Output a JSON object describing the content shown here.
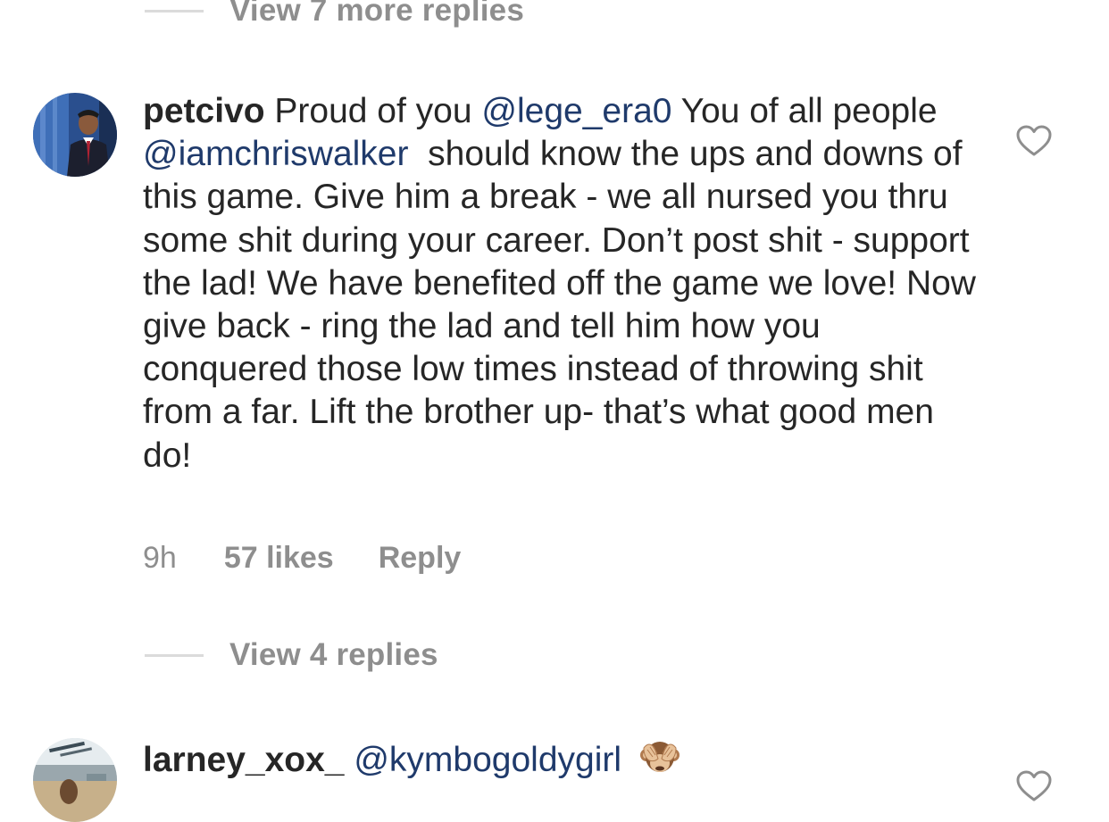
{
  "thread_top": {
    "view_replies_label": "View 7 more replies"
  },
  "comment_1": {
    "username": "petcivo",
    "segments": {
      "t1": " Proud of you ",
      "m1": "@lege_era0",
      "t2": " You of all people ",
      "m2": "@iamchriswalker",
      "t3": "  should know the ups and downs of this game. Give him a break - we all nursed you thru some shit during your career. Don’t post shit - support the lad! We have benefited off the game we love! Now give back - ring the lad and tell him how you conquered those low times instead of throwing shit from a far. Lift the brother up- that’s what good men do!"
    },
    "time": "9h",
    "likes": "57 likes",
    "reply_label": "Reply",
    "view_replies_label": "View 4 replies",
    "like_icon": "heart-outline-icon"
  },
  "comment_2": {
    "username": "larney_xox_",
    "mention": "@kymbogoldygirl",
    "emoji": "see-no-evil-monkey",
    "like_icon": "heart-outline-icon"
  },
  "colors": {
    "text": "#262626",
    "secondary": "#8e8e8e",
    "mention": "#1f3a6b",
    "divider": "#dbdbdb"
  }
}
